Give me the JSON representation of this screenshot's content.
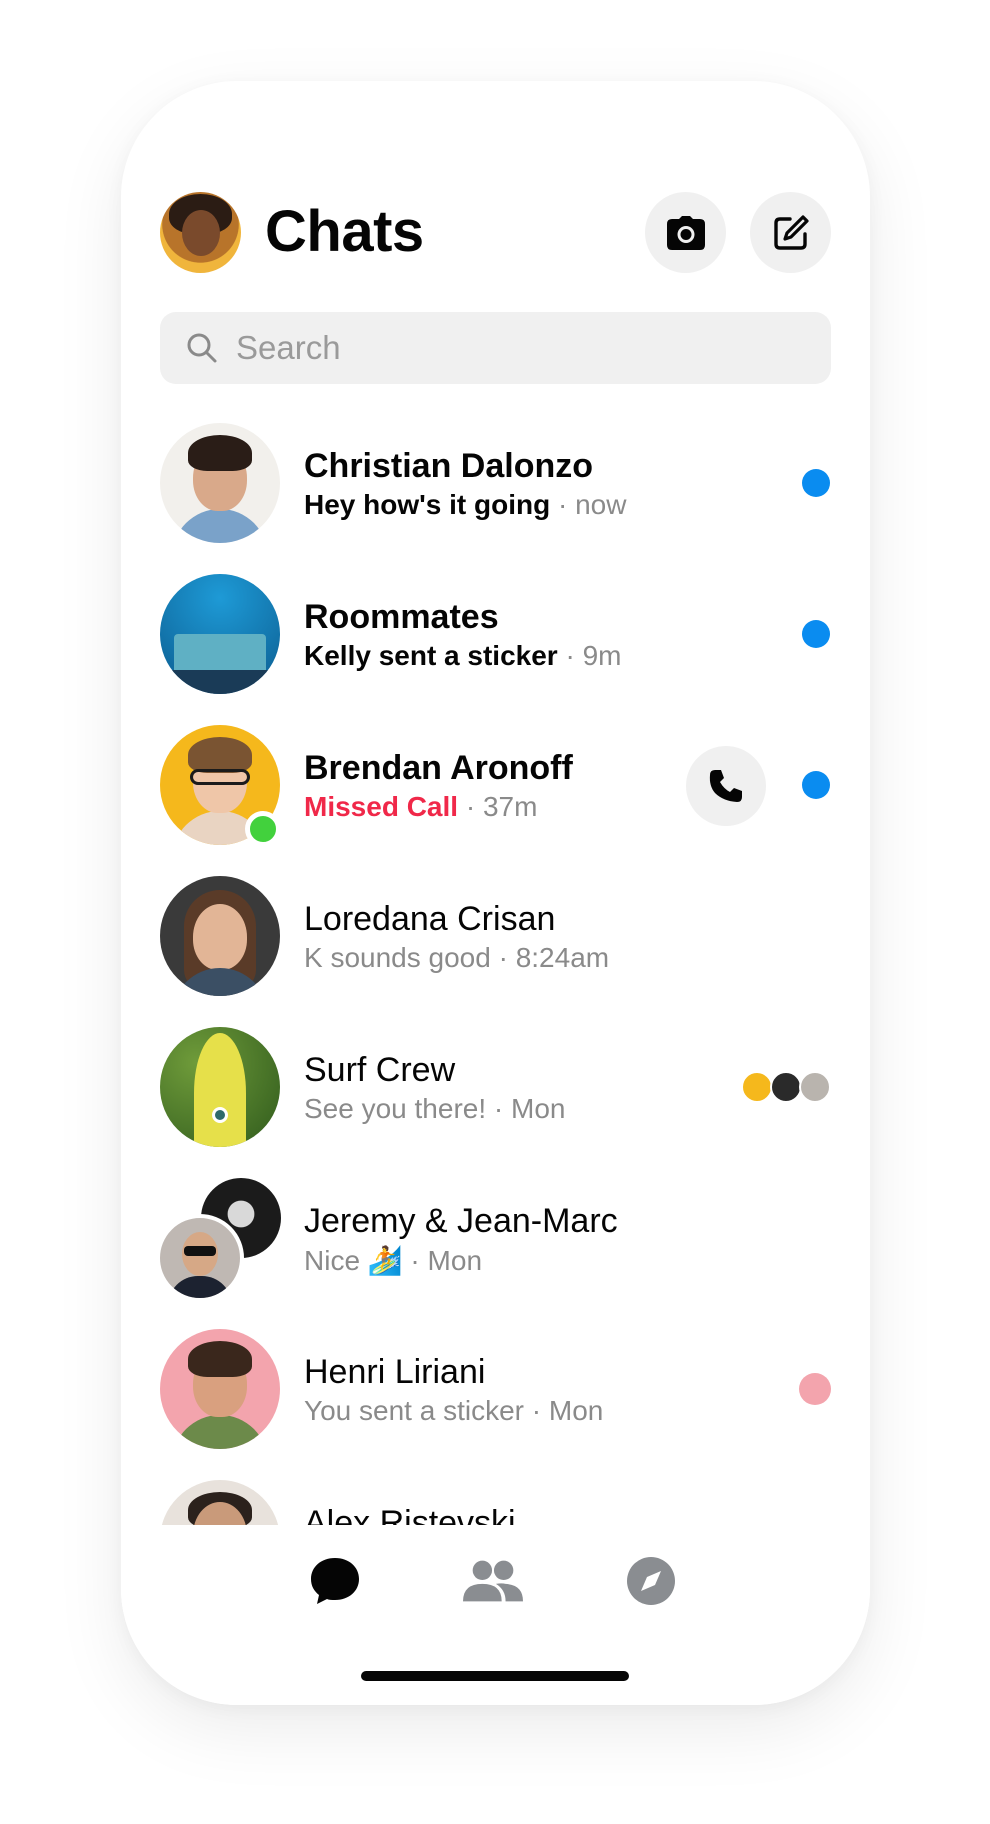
{
  "header": {
    "title": "Chats",
    "camera_icon": "camera-icon",
    "compose_icon": "compose-icon"
  },
  "search": {
    "placeholder": "Search",
    "value": ""
  },
  "conversations": [
    {
      "name": "Christian Dalonzo",
      "message": "Hey how's it going",
      "sep": " · ",
      "time": "now",
      "unread": true
    },
    {
      "name": "Roommates",
      "message": "Kelly sent a sticker",
      "sep": " · ",
      "time": "9m",
      "unread": true
    },
    {
      "name": "Brendan Aronoff",
      "message": "Missed Call",
      "sep": " · ",
      "time": "37m",
      "unread": true,
      "online": true,
      "call_icon": "phone-icon"
    },
    {
      "name": "Loredana Crisan",
      "message": "K sounds good",
      "sep": " · ",
      "time": "8:24am"
    },
    {
      "name": "Surf Crew",
      "message": "See you there!",
      "sep": " · ",
      "time": "Mon"
    },
    {
      "name": "Jeremy & Jean-Marc",
      "message": "Nice 🏄",
      "sep": " · ",
      "time": "Mon"
    },
    {
      "name": "Henri Liriani",
      "message": "You sent a sticker",
      "sep": " · ",
      "time": "Mon"
    },
    {
      "name": "Alex Ristevski"
    }
  ],
  "tabs": [
    {
      "icon": "chat-bubble-icon",
      "active": true
    },
    {
      "icon": "people-icon"
    },
    {
      "icon": "compass-icon"
    }
  ],
  "colors": {
    "unread": "#0a8cf0",
    "missed": "#f02849",
    "online": "#42d13d",
    "active_tab": "#050505",
    "inactive_tab": "#8a8d91"
  }
}
